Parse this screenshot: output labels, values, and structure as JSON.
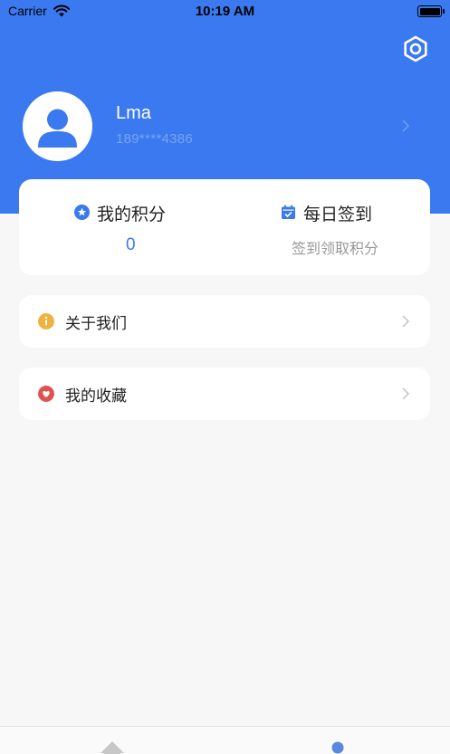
{
  "status_bar": {
    "carrier": "Carrier",
    "time": "10:19 AM"
  },
  "profile": {
    "name": "Lma",
    "phone": "189****4386"
  },
  "points_card": {
    "points_title": "我的积分",
    "points_value": "0",
    "checkin_title": "每日签到",
    "checkin_sub": "签到领取积分"
  },
  "menu": [
    {
      "label": "关于我们",
      "icon": "info-icon",
      "color": "#f0b23e"
    },
    {
      "label": "我的收藏",
      "icon": "heart-icon",
      "color": "#e0524f"
    }
  ],
  "tabbar": {
    "items": [
      {
        "icon": "home-icon"
      },
      {
        "icon": "person-icon",
        "active": true
      }
    ]
  },
  "colors": {
    "primary": "#3a79f0",
    "background": "#f7f7f7"
  }
}
